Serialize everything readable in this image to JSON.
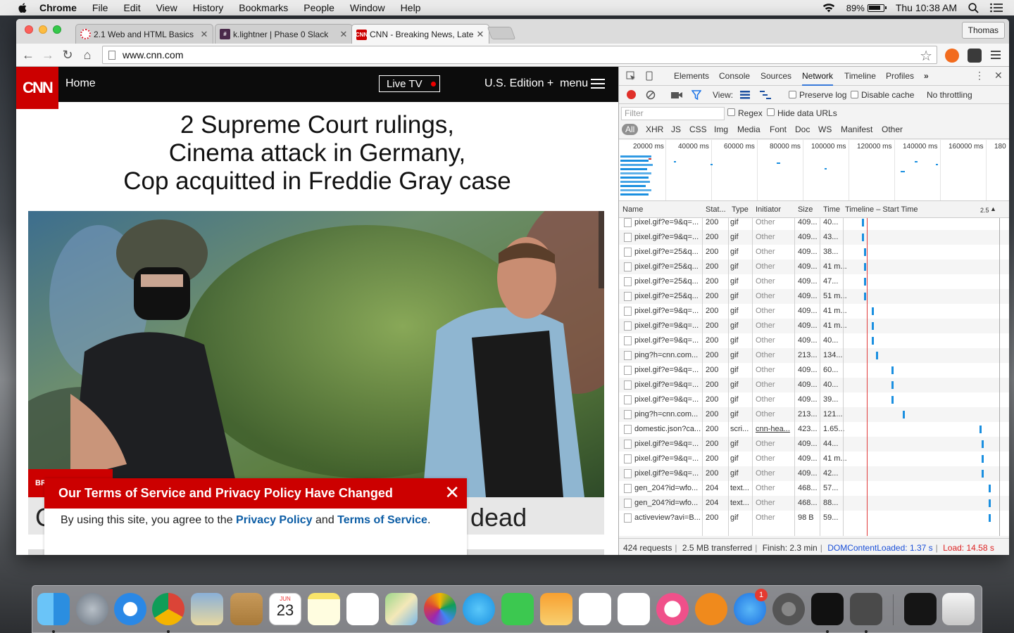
{
  "menubar": {
    "app": "Chrome",
    "items": [
      "File",
      "Edit",
      "View",
      "History",
      "Bookmarks",
      "People",
      "Window",
      "Help"
    ],
    "battery": "89%",
    "clock": "Thu 10:38 AM"
  },
  "browser": {
    "tabs": [
      {
        "title": "2.1 Web and HTML Basics",
        "icon": "learn-icon",
        "active": false
      },
      {
        "title": "k.lightner | Phase 0 Slack",
        "icon": "slack-icon",
        "active": false
      },
      {
        "title": "CNN - Breaking News, Late",
        "icon": "cnn-icon",
        "active": true
      }
    ],
    "profile": "Thomas",
    "url": "www.cnn.com"
  },
  "cnn": {
    "logo": "CNN",
    "home": "Home",
    "live_tv": "Live TV",
    "edition": "U.S. Edition +",
    "menu": "menu",
    "headline_lines": [
      "2 Supreme Court rulings,",
      "Cinema attack in Germany,",
      "Cop acquitted in Freddie Gray case"
    ],
    "strip_text": "dead",
    "strip_left": "C",
    "breaking_tag": "BR",
    "tos_title": "Our Terms of Service and Privacy Policy Have Changed",
    "tos_prefix": "By using this site, you agree to the",
    "tos_link1": "Privacy Policy",
    "tos_and": "and",
    "tos_link2": "Terms of Service",
    "tos_suffix": "."
  },
  "devtools": {
    "tabs": [
      "Elements",
      "Console",
      "Sources",
      "Network",
      "Timeline",
      "Profiles"
    ],
    "active_tab": "Network",
    "more": "»",
    "controls": {
      "view": "View:",
      "preserve_log": "Preserve log",
      "disable_cache": "Disable cache",
      "throttling": "No throttling"
    },
    "filter_placeholder": "Filter",
    "regex": "Regex",
    "hide_data_urls": "Hide data URLs",
    "types": [
      "All",
      "XHR",
      "JS",
      "CSS",
      "Img",
      "Media",
      "Font",
      "Doc",
      "WS",
      "Manifest",
      "Other"
    ],
    "overview_ticks": [
      "20000 ms",
      "40000 ms",
      "60000 ms",
      "80000 ms",
      "100000 ms",
      "120000 ms",
      "140000 ms",
      "160000 ms",
      "180"
    ],
    "columns": [
      "Name",
      "Stat...",
      "Type",
      "Initiator",
      "Size",
      "Time",
      "Timeline – Start Time",
      "2.5"
    ],
    "rows": [
      {
        "name": "pixel.gif?e=9&q=...",
        "status": "200",
        "type": "gif",
        "initiator": "Other",
        "size": "409...",
        "time": "40...",
        "bar": 0.11
      },
      {
        "name": "pixel.gif?e=9&q=...",
        "status": "200",
        "type": "gif",
        "initiator": "Other",
        "size": "409...",
        "time": "43...",
        "bar": 0.11
      },
      {
        "name": "pixel.gif?e=25&q...",
        "status": "200",
        "type": "gif",
        "initiator": "Other",
        "size": "409...",
        "time": "38...",
        "bar": 0.125
      },
      {
        "name": "pixel.gif?e=25&q...",
        "status": "200",
        "type": "gif",
        "initiator": "Other",
        "size": "409...",
        "time": "41 m...",
        "bar": 0.125
      },
      {
        "name": "pixel.gif?e=25&q...",
        "status": "200",
        "type": "gif",
        "initiator": "Other",
        "size": "409...",
        "time": "47...",
        "bar": 0.125
      },
      {
        "name": "pixel.gif?e=25&q...",
        "status": "200",
        "type": "gif",
        "initiator": "Other",
        "size": "409...",
        "time": "51 m...",
        "bar": 0.125
      },
      {
        "name": "pixel.gif?e=9&q=...",
        "status": "200",
        "type": "gif",
        "initiator": "Other",
        "size": "409...",
        "time": "41 m...",
        "bar": 0.175
      },
      {
        "name": "pixel.gif?e=9&q=...",
        "status": "200",
        "type": "gif",
        "initiator": "Other",
        "size": "409...",
        "time": "41 m...",
        "bar": 0.175
      },
      {
        "name": "pixel.gif?e=9&q=...",
        "status": "200",
        "type": "gif",
        "initiator": "Other",
        "size": "409...",
        "time": "40...",
        "bar": 0.175
      },
      {
        "name": "ping?h=cnn.com...",
        "status": "200",
        "type": "gif",
        "initiator": "Other",
        "size": "213...",
        "time": "134...",
        "bar": 0.2
      },
      {
        "name": "pixel.gif?e=9&q=...",
        "status": "200",
        "type": "gif",
        "initiator": "Other",
        "size": "409...",
        "time": "60...",
        "bar": 0.3
      },
      {
        "name": "pixel.gif?e=9&q=...",
        "status": "200",
        "type": "gif",
        "initiator": "Other",
        "size": "409...",
        "time": "40...",
        "bar": 0.3
      },
      {
        "name": "pixel.gif?e=9&q=...",
        "status": "200",
        "type": "gif",
        "initiator": "Other",
        "size": "409...",
        "time": "39...",
        "bar": 0.3
      },
      {
        "name": "ping?h=cnn.com...",
        "status": "200",
        "type": "gif",
        "initiator": "Other",
        "size": "213...",
        "time": "121...",
        "bar": 0.375
      },
      {
        "name": "domestic.json?ca...",
        "status": "200",
        "type": "scri...",
        "initiator": "cnn-hea...",
        "size": "423...",
        "time": "1.65...",
        "bar": 0.87
      },
      {
        "name": "pixel.gif?e=9&q=...",
        "status": "200",
        "type": "gif",
        "initiator": "Other",
        "size": "409...",
        "time": "44...",
        "bar": 0.885
      },
      {
        "name": "pixel.gif?e=9&q=...",
        "status": "200",
        "type": "gif",
        "initiator": "Other",
        "size": "409...",
        "time": "41 m...",
        "bar": 0.885
      },
      {
        "name": "pixel.gif?e=9&q=...",
        "status": "200",
        "type": "gif",
        "initiator": "Other",
        "size": "409...",
        "time": "42...",
        "bar": 0.885
      },
      {
        "name": "gen_204?id=wfo...",
        "status": "204",
        "type": "text...",
        "initiator": "Other",
        "size": "468...",
        "time": "57...",
        "bar": 0.93
      },
      {
        "name": "gen_204?id=wfo...",
        "status": "204",
        "type": "text...",
        "initiator": "Other",
        "size": "468...",
        "time": "88...",
        "bar": 0.93
      },
      {
        "name": "activeview?avi=B...",
        "status": "200",
        "type": "gif",
        "initiator": "Other",
        "size": "98 B",
        "time": "59...",
        "bar": 0.93
      }
    ],
    "status": {
      "requests": "424 requests",
      "transferred": "2.5 MB transferred",
      "finish": "Finish: 2.3 min",
      "dom": "DOMContentLoaded: 1.37 s",
      "load": "Load: 14.58 s"
    }
  },
  "dock": {
    "apps": [
      "finder-icon",
      "launchpad-icon",
      "safari-icon",
      "chrome-icon",
      "preview-icon",
      "contacts-icon",
      "calendar-icon",
      "notes-icon",
      "reminders-icon",
      "maps-icon",
      "photos-icon",
      "messages-icon",
      "facetime-icon",
      "pages-icon",
      "numbers-icon",
      "keynote-icon",
      "itunes-icon",
      "ibooks-icon",
      "appstore-icon",
      "system-preferences-icon",
      "terminal-icon",
      "sublime-icon",
      "terminal-window-icon",
      "trash-icon"
    ],
    "calendar_month": "JUN",
    "calendar_day": "23",
    "appstore_badge": "1"
  }
}
